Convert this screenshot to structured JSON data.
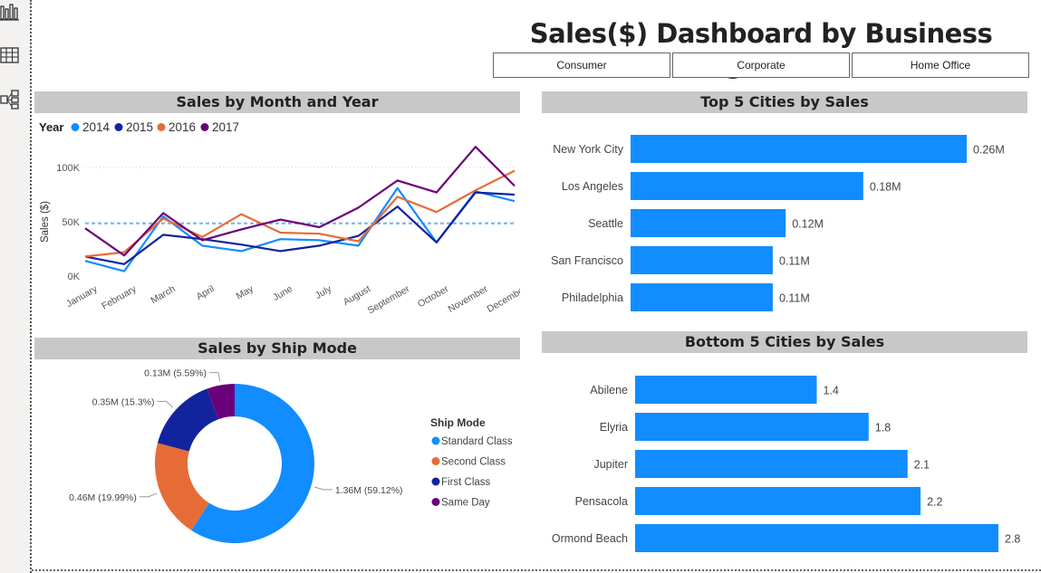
{
  "title": "Sales($) Dashboard by Business Segments",
  "slicers": [
    "Consumer",
    "Corporate",
    "Home Office"
  ],
  "sidebar": {
    "icons": [
      "report-view-icon",
      "data-view-icon",
      "model-view-icon"
    ]
  },
  "panels": {
    "line": "Sales by Month and Year",
    "top5": "Top 5 Cities by Sales",
    "ship": "Sales by Ship Mode",
    "bottom5": "Bottom 5 Cities by Sales"
  },
  "chart_data": [
    {
      "type": "line",
      "title": "Sales by Month and Year",
      "legend_title": "Year",
      "ylabel": "Sales ($)",
      "xlabel": "",
      "ylim": [
        0,
        100000
      ],
      "yticks": [
        0,
        50000,
        100000
      ],
      "ytick_labels": [
        "0K",
        "50K",
        "100K"
      ],
      "average_line": 48500,
      "categories": [
        "January",
        "February",
        "March",
        "April",
        "May",
        "June",
        "July",
        "August",
        "September",
        "October",
        "November",
        "December"
      ],
      "series": [
        {
          "name": "2014",
          "color": "#118dff",
          "values": [
            14000,
            4500,
            55000,
            28000,
            23000,
            34000,
            33000,
            28000,
            81000,
            31000,
            78000,
            69000
          ]
        },
        {
          "name": "2015",
          "color": "#12239e",
          "values": [
            18000,
            11000,
            38000,
            34000,
            29000,
            23000,
            28000,
            37000,
            64000,
            31000,
            77000,
            75000
          ]
        },
        {
          "name": "2016",
          "color": "#e66c37",
          "values": [
            18000,
            22000,
            53000,
            36000,
            57000,
            40000,
            39000,
            32000,
            73000,
            59000,
            79000,
            97000
          ]
        },
        {
          "name": "2017",
          "color": "#6b007b",
          "values": [
            44000,
            19000,
            58000,
            33000,
            43000,
            52000,
            45000,
            63000,
            88000,
            77000,
            119000,
            83000
          ]
        }
      ]
    },
    {
      "type": "bar",
      "title": "Top 5 Cities by Sales",
      "orientation": "horizontal",
      "color": "#118dff",
      "categories": [
        "New York City",
        "Los Angeles",
        "Seattle",
        "San Francisco",
        "Philadelphia"
      ],
      "values": [
        0.26,
        0.18,
        0.12,
        0.11,
        0.11
      ],
      "labels": [
        "0.26M",
        "0.18M",
        "0.12M",
        "0.11M",
        "0.11M"
      ]
    },
    {
      "type": "pie",
      "variant": "donut",
      "title": "Sales by Ship Mode",
      "legend_title": "Ship Mode",
      "slices": [
        {
          "name": "Standard Class",
          "value": 1.36,
          "percent": 59.12,
          "label": "1.36M (59.12%)",
          "color": "#118dff"
        },
        {
          "name": "Second Class",
          "value": 0.46,
          "percent": 19.99,
          "label": "0.46M (19.99%)",
          "color": "#e66c37"
        },
        {
          "name": "First Class",
          "value": 0.35,
          "percent": 15.3,
          "label": "0.35M (15.3%)",
          "color": "#12239e"
        },
        {
          "name": "Same Day",
          "value": 0.13,
          "percent": 5.59,
          "label": "0.13M (5.59%)",
          "color": "#6b007b"
        }
      ]
    },
    {
      "type": "bar",
      "title": "Bottom 5 Cities by Sales",
      "orientation": "horizontal",
      "color": "#118dff",
      "categories": [
        "Abilene",
        "Elyria",
        "Jupiter",
        "Pensacola",
        "Ormond Beach"
      ],
      "values": [
        1.4,
        1.8,
        2.1,
        2.2,
        2.8
      ],
      "labels": [
        "1.4",
        "1.8",
        "2.1",
        "2.2",
        "2.8"
      ]
    }
  ]
}
